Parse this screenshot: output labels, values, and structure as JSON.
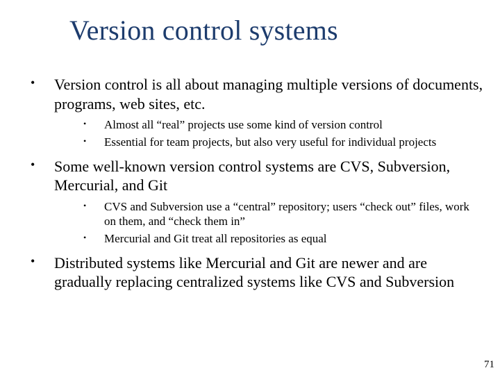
{
  "title": "Version control systems",
  "bullets": [
    {
      "text": "Version control  is all about managing multiple versions of documents, programs, web sites, etc.",
      "sub": [
        "Almost all “real” projects use some kind of version control",
        "Essential for team projects, but also very useful for individual projects"
      ]
    },
    {
      "text": "Some well-known version control systems are CVS, Subversion, Mercurial, and Git",
      "sub": [
        "CVS and Subversion use a “central” repository; users “check out” files, work on them, and “check them in”",
        "Mercurial and Git treat all repositories as equal"
      ]
    },
    {
      "text": "Distributed systems like Mercurial and Git are newer and are gradually replacing centralized systems like CVS and Subversion",
      "sub": []
    }
  ],
  "page_number": "71"
}
